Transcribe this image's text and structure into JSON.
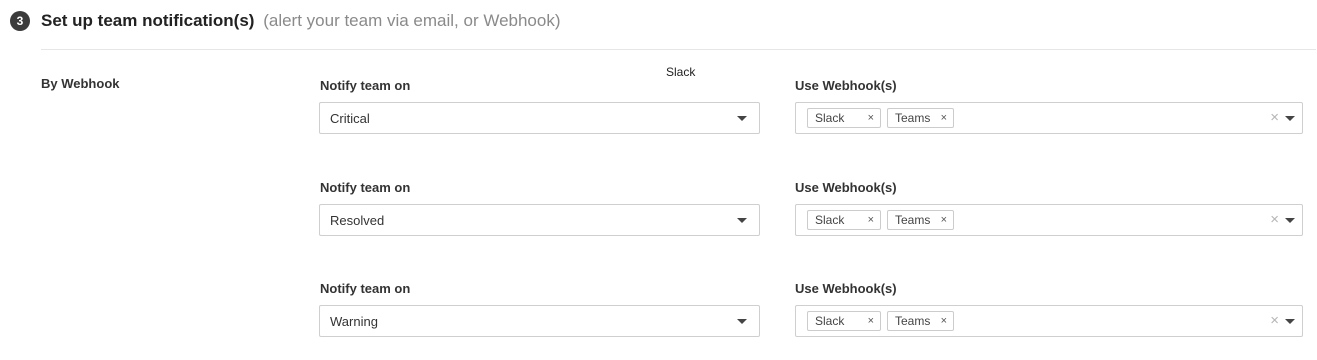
{
  "section": {
    "step_number": "3",
    "title": "Set up team notification(s)",
    "subtitle": "(alert your team via email, or Webhook)"
  },
  "group": {
    "label": "By Webhook"
  },
  "tooltip": {
    "text": "Slack"
  },
  "rows": [
    {
      "notify_label": "Notify team on",
      "notify_value": "Critical",
      "webhook_label": "Use Webhook(s)",
      "webhooks": [
        "Slack",
        "Teams"
      ]
    },
    {
      "notify_label": "Notify team on",
      "notify_value": "Resolved",
      "webhook_label": "Use Webhook(s)",
      "webhooks": [
        "Slack",
        "Teams"
      ]
    },
    {
      "notify_label": "Notify team on",
      "notify_value": "Warning",
      "webhook_label": "Use Webhook(s)",
      "webhooks": [
        "Slack",
        "Teams"
      ]
    }
  ],
  "icons": {
    "remove_chip": "close-icon",
    "clear_all": "clear-icon",
    "dropdown": "caret-down-icon"
  },
  "colors": {
    "badge_bg": "#3b3b3b",
    "title": "#222222",
    "subtitle": "#8a8a8a",
    "border": "#cfcfcf"
  }
}
